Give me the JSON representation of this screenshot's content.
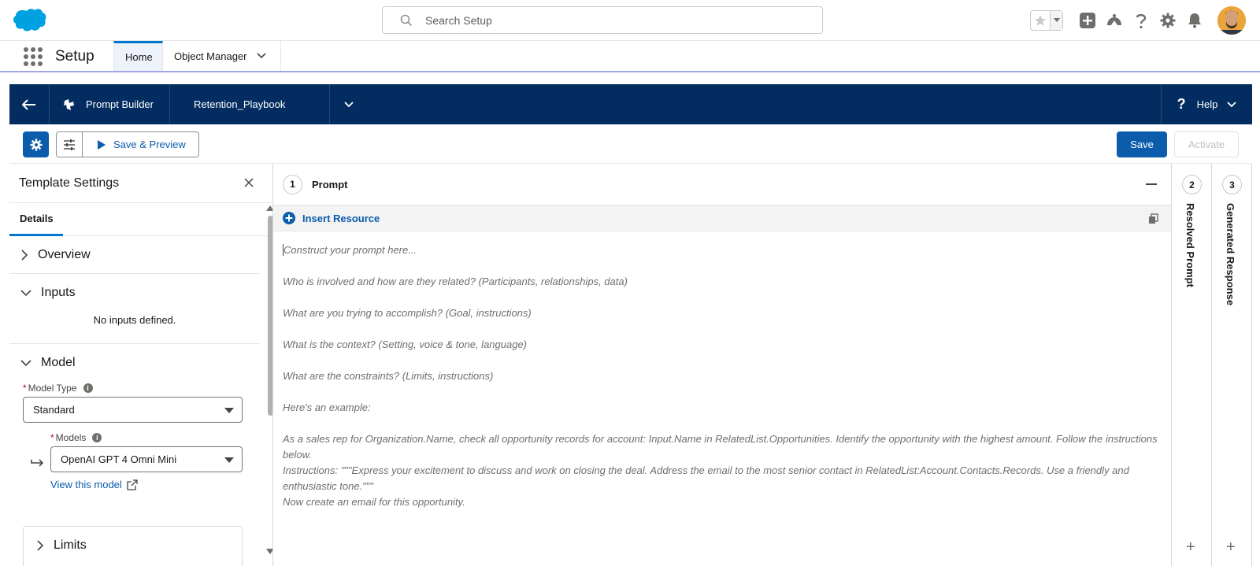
{
  "header": {
    "search_placeholder": "Search Setup",
    "icons": [
      "favorites-star-icon",
      "add-icon",
      "trailhead-icon",
      "help-icon",
      "settings-gear-icon",
      "notifications-bell-icon"
    ]
  },
  "context_nav": {
    "app_name": "Setup",
    "tabs": [
      {
        "label": "Home",
        "active": true
      },
      {
        "label": "Object Manager",
        "active": false
      }
    ]
  },
  "builder": {
    "title": "Prompt Builder",
    "template_name": "Retention_Playbook",
    "help_label": "Help"
  },
  "toolbar": {
    "preview_label": "Save & Preview",
    "save_label": "Save",
    "activate_label": "Activate"
  },
  "template_settings": {
    "title": "Template Settings",
    "tab_label": "Details",
    "sections": {
      "overview": "Overview",
      "inputs": "Inputs",
      "no_inputs": "No inputs defined.",
      "model": "Model",
      "limits": "Limits"
    },
    "model_type_label": "Model Type",
    "model_type_value": "Standard",
    "models_label": "Models",
    "models_value": "OpenAI GPT 4 Omni Mini",
    "view_model_link": "View this model"
  },
  "prompt": {
    "step_number": "1",
    "title": "Prompt",
    "insert_resource_label": "Insert Resource",
    "lines": {
      "l1": "Construct your prompt here...",
      "l2": "Who is involved and how are they related? (Participants, relationships, data)",
      "l3": "What are you trying to accomplish? (Goal, instructions)",
      "l4": "What is the context? (Setting, voice & tone, language)",
      "l5": "What are the constraints? (Limits, instructions)",
      "l6": "Here's an example:",
      "l7": "As a sales rep for Organization.Name, check all opportunity records for account: Input.Name in RelatedList.Opportunities. Identify the opportunity with the highest amount. Follow the instructions below.",
      "l8": "Instructions: \"\"\"Express your excitement to discuss and work on closing the deal. Address the email to the most senior contact in RelatedList:Account.Contacts.Records. Use a friendly and enthusiastic tone.\"\"\"",
      "l9": "Now create an email for this opportunity."
    }
  },
  "side_panels": [
    {
      "step": "2",
      "label": "Resolved Prompt"
    },
    {
      "step": "3",
      "label": "Generated Response"
    }
  ],
  "colors": {
    "brand_blue": "#0b5cab",
    "header_navy": "#032d60",
    "salesforce_cloud": "#00a1e0"
  }
}
